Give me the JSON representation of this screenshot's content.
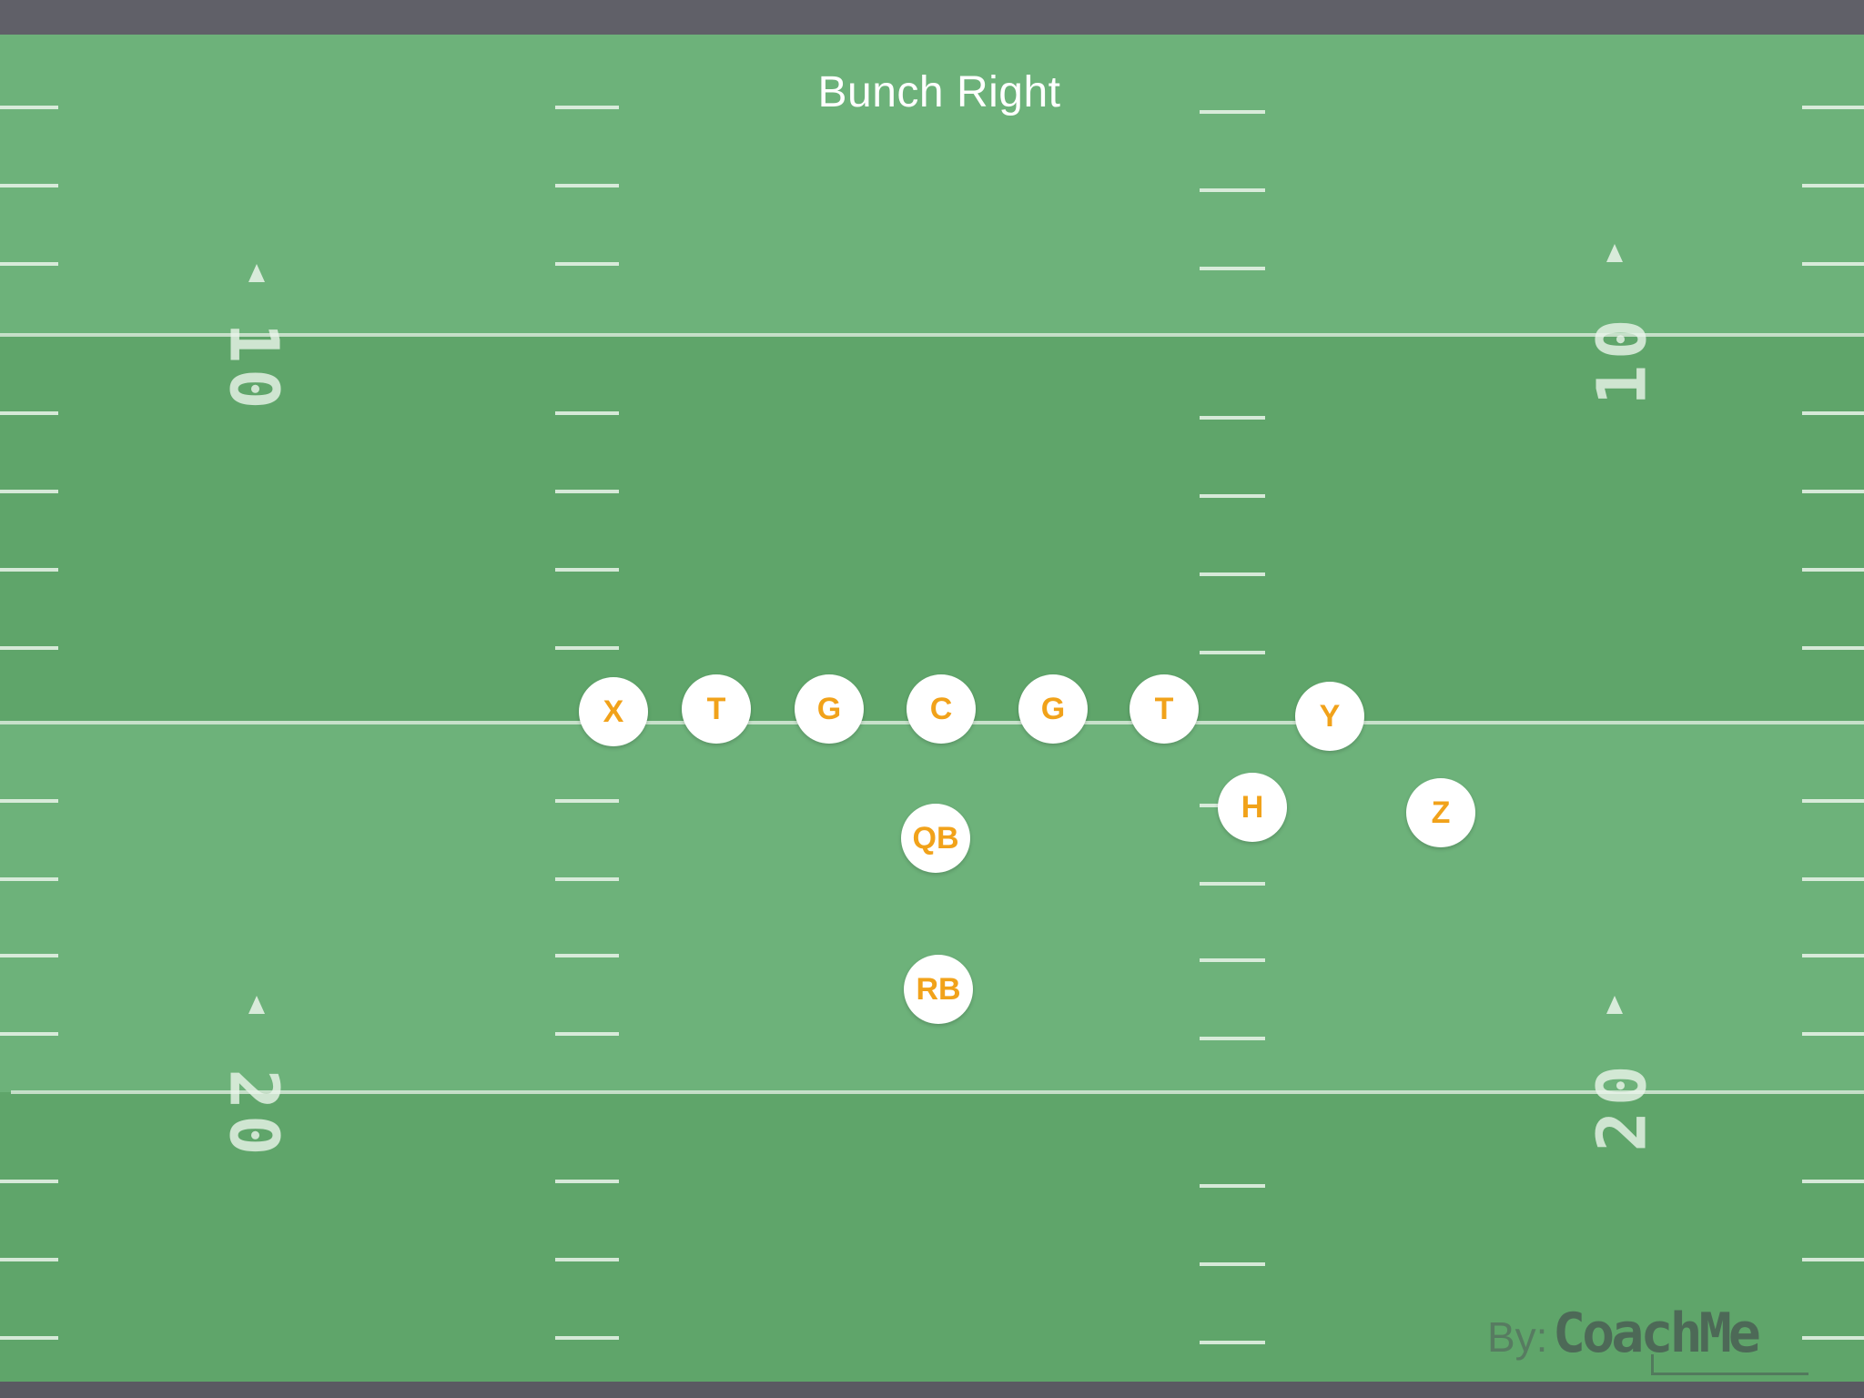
{
  "play": {
    "title": "Bunch Right"
  },
  "field": {
    "yard_numbers": {
      "upper": "10",
      "lower": "20"
    }
  },
  "players": [
    {
      "label": "X"
    },
    {
      "label": "T"
    },
    {
      "label": "G"
    },
    {
      "label": "C"
    },
    {
      "label": "G"
    },
    {
      "label": "T"
    },
    {
      "label": "Y"
    },
    {
      "label": "H"
    },
    {
      "label": "Z"
    },
    {
      "label": "QB"
    },
    {
      "label": "RB"
    }
  ],
  "watermark": {
    "prefix": "By:",
    "brand": "CoachMe"
  },
  "colors": {
    "field": "#66ab6f",
    "player_fill": "#ffffff",
    "player_text": "#f1a21a",
    "lines": "#e6f0e6"
  }
}
